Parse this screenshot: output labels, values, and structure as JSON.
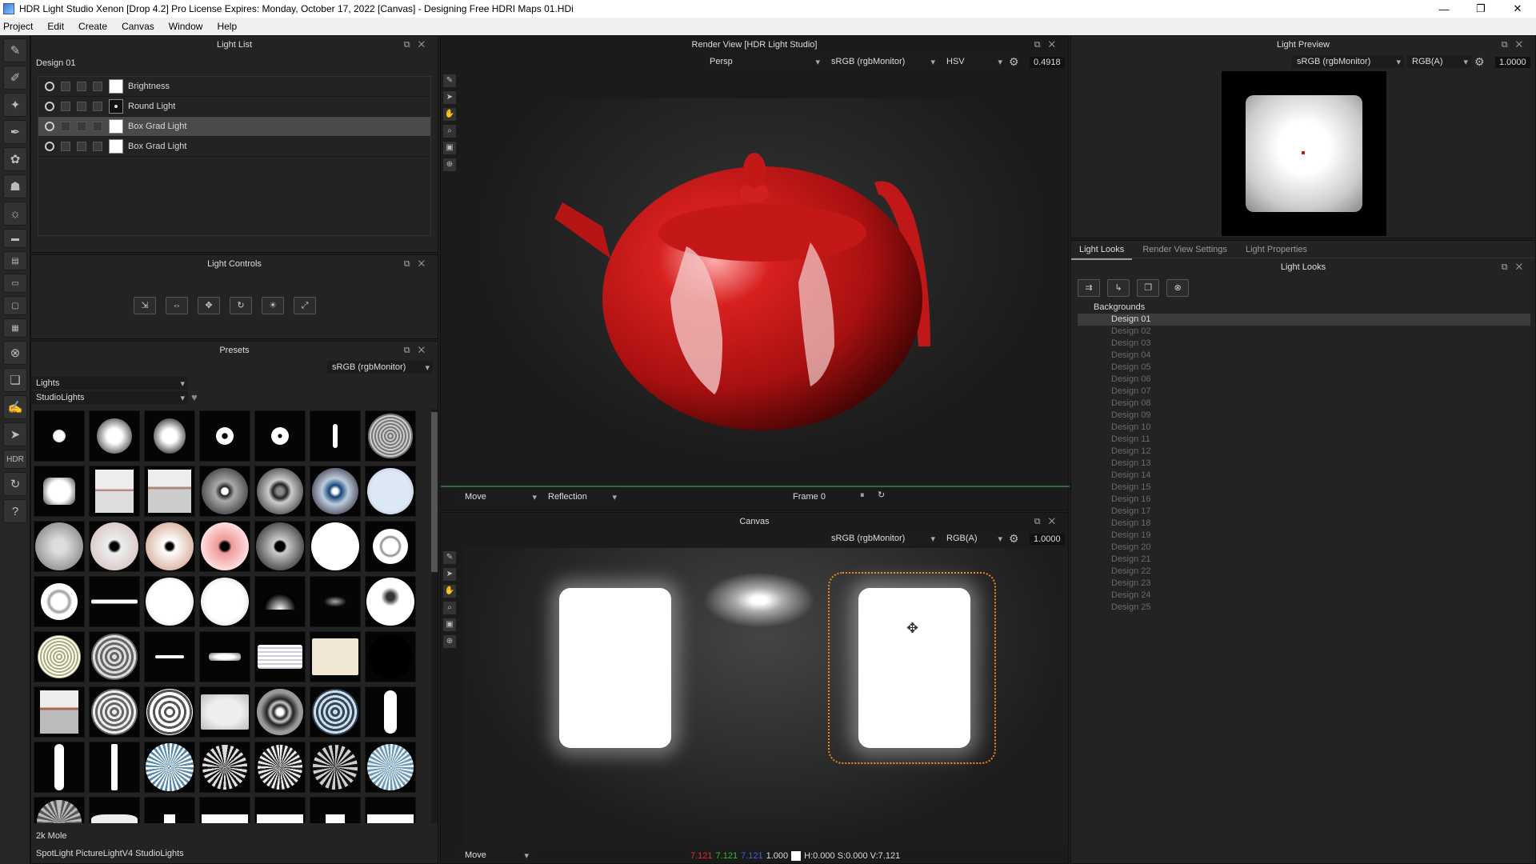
{
  "titlebar": {
    "title": "HDR Light Studio Xenon [Drop 4.2] Pro License Expires: Monday, October 17, 2022  [Canvas] - Designing Free HDRI Maps 01.HDi",
    "minimize": "—",
    "restore": "❐",
    "close": "✕"
  },
  "menu": [
    "Project",
    "Edit",
    "Create",
    "Canvas",
    "Window",
    "Help"
  ],
  "light_list": {
    "title": "Light List",
    "design": "Design 01",
    "items": [
      {
        "label": "Brightness",
        "swatch": "white"
      },
      {
        "label": "Round Light",
        "swatch": "dot"
      },
      {
        "label": "Box Grad Light",
        "swatch": "white"
      },
      {
        "label": "Box Grad Light",
        "swatch": "white"
      }
    ]
  },
  "light_controls": {
    "title": "Light Controls"
  },
  "presets": {
    "title": "Presets",
    "colorspace": "sRGB (rgbMonitor)",
    "category": "Lights",
    "subcategory": "StudioLights",
    "selected_name": "2k Mole",
    "status": "SpotLight PictureLightV4 StudioLights"
  },
  "render_view": {
    "title": "Render View [HDR Light Studio]",
    "camera": "Persp",
    "colorspace": "sRGB (rgbMonitor)",
    "channel": "HSV",
    "exposure": "0.4918",
    "mode": "Move",
    "shading": "Reflection",
    "frame": "Frame 0"
  },
  "canvas": {
    "title": "Canvas",
    "colorspace": "sRGB (rgbMonitor)",
    "channel": "RGB(A)",
    "exposure": "1.0000",
    "mode": "Move",
    "status_r": "7.121",
    "status_g": "7.121",
    "status_b": "7.121",
    "status_a": "1.000",
    "status_hsv": "H:0.000 S:0.000 V:7.121"
  },
  "light_preview": {
    "title": "Light Preview",
    "colorspace": "sRGB (rgbMonitor)",
    "channel": "RGB(A)",
    "exposure": "1.0000"
  },
  "right_tabs": [
    "Light Looks",
    "Render View Settings",
    "Light Properties"
  ],
  "light_looks": {
    "title": "Light Looks",
    "root": "Backgrounds",
    "items": [
      "Design 01",
      "Design 02",
      "Design 03",
      "Design 04",
      "Design 05",
      "Design 06",
      "Design 07",
      "Design 08",
      "Design 09",
      "Design 10",
      "Design 11",
      "Design 12",
      "Design 13",
      "Design 14",
      "Design 15",
      "Design 16",
      "Design 17",
      "Design 18",
      "Design 19",
      "Design 20",
      "Design 21",
      "Design 22",
      "Design 23",
      "Design 24",
      "Design 25"
    ]
  },
  "colors": {
    "accent_red": "#c41818",
    "panel_bg": "#232323",
    "status_red": "#e03030",
    "status_green": "#30c030",
    "status_blue": "#4060e0"
  }
}
